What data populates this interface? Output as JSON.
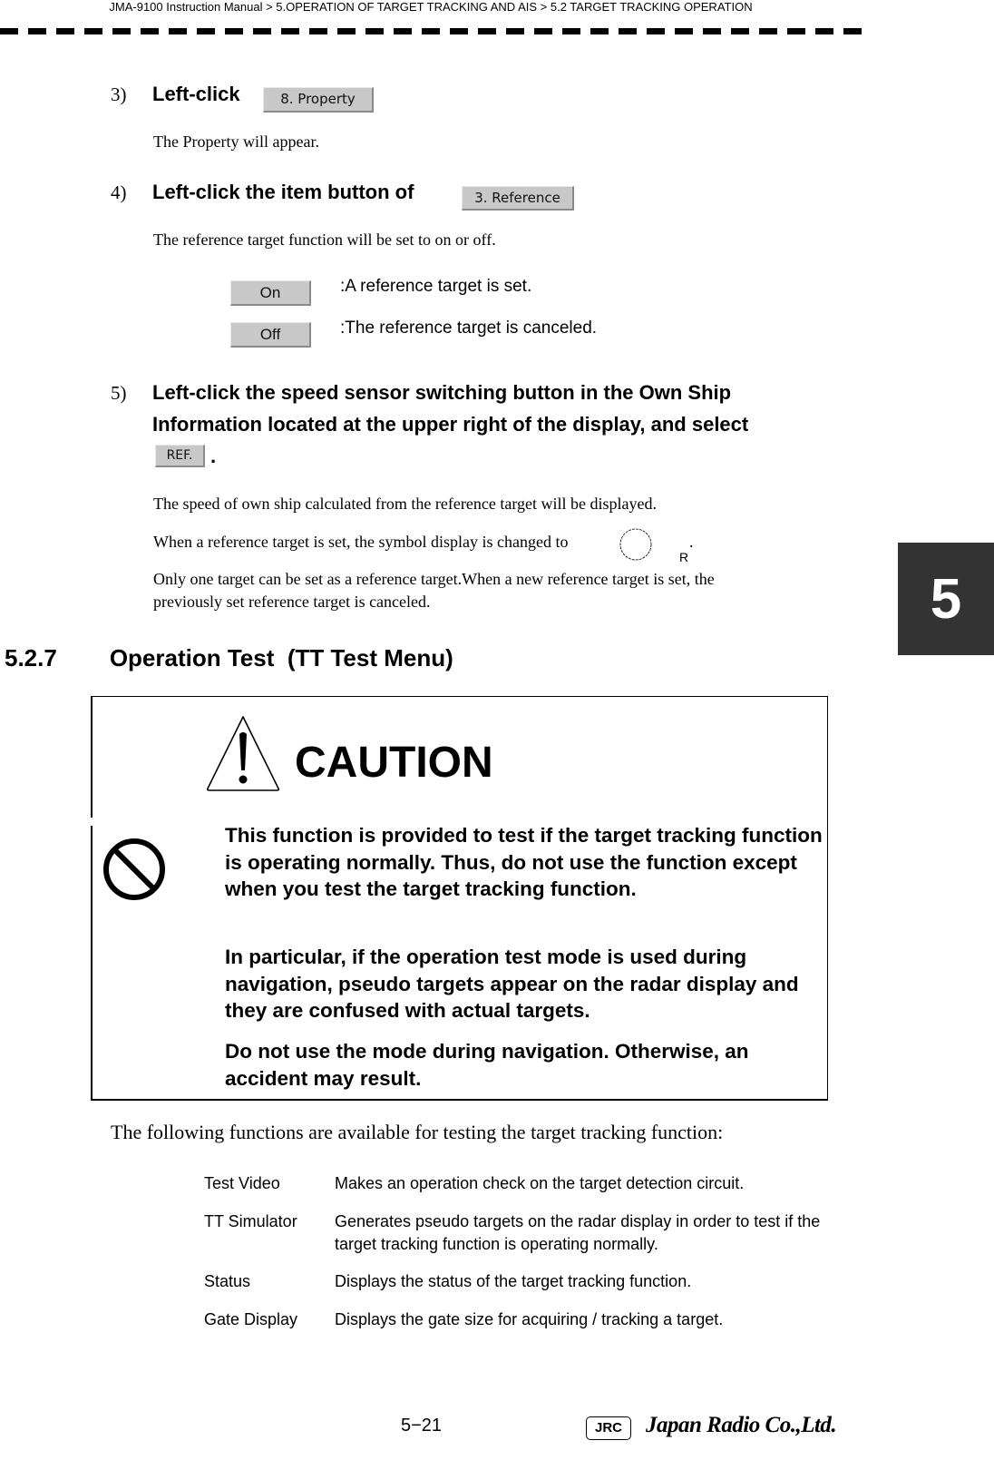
{
  "header": {
    "breadcrumb": "JMA-9100 Instruction Manual > 5.OPERATION OF TARGET TRACKING AND AIS > 5.2  TARGET TRACKING OPERATION"
  },
  "chapter_tab": "5",
  "steps": [
    {
      "number": "3)",
      "instruction": "Left-click",
      "button_label": "8. Property",
      "description": "The Property will appear."
    },
    {
      "number": "4)",
      "instruction": "Left-click the item button of",
      "button_label": "3. Reference",
      "description": "The reference target function will be set to on or off.",
      "options": [
        {
          "button_label": "On",
          "description": ":A reference target is set."
        },
        {
          "button_label": "Off",
          "description": ":The reference target is canceled."
        }
      ]
    },
    {
      "number": "5)",
      "instruction_line1": "Left-click the speed sensor switching button in the Own Ship",
      "instruction_line2": "Information located at the upper right of the display, and select",
      "button_label": "REF.",
      "trailing": ".",
      "paragraphs": [
        "The speed of own ship calculated from the reference target will be displayed.",
        "When a reference target is set, the symbol display is changed to",
        "Only one target can be set as a reference target.When a new reference target is set, the",
        "previously set reference target is canceled."
      ],
      "symbol_label": "R",
      "symbol_trailing": "."
    }
  ],
  "section": {
    "number": "5.2.7",
    "title": "Operation Test  (TT Test Menu)"
  },
  "caution": {
    "title": "CAUTION",
    "paragraphs": [
      "This function is provided to test if the target tracking function is operating normally. Thus, do not use the function except when you test the target tracking function.",
      "In particular, if the operation test mode is used during navigation, pseudo targets appear on the radar display and they are confused with actual targets.",
      "Do not use the mode during navigation. Otherwise, an accident may result."
    ]
  },
  "functions_intro": "The following functions are available for testing the target tracking function:",
  "functions": [
    {
      "name": "Test Video",
      "description": "Makes an operation check on the target detection circuit."
    },
    {
      "name": "TT Simulator",
      "description": "Generates pseudo targets on the radar display in order to test if the target tracking function is operating normally."
    },
    {
      "name": "Status",
      "description": "Displays the status of the target tracking function."
    },
    {
      "name": "Gate Display",
      "description": "Displays the gate size for acquiring / tracking a target."
    }
  ],
  "footer": {
    "page_number": "5−21",
    "logo_badge": "JRC",
    "company": "Japan Radio Co.,Ltd."
  }
}
